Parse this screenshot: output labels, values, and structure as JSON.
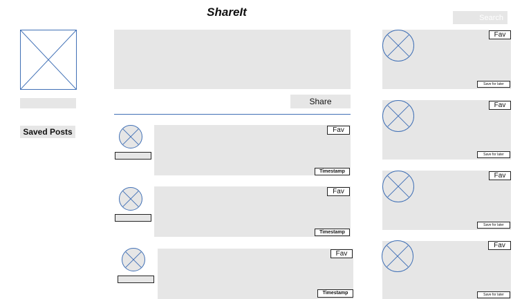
{
  "header": {
    "title": "ShareIt",
    "search_placeholder": "Search"
  },
  "sidebar": {
    "saved_posts_label": "Saved Posts"
  },
  "composer": {
    "share_label": "Share"
  },
  "feed": {
    "posts": [
      {
        "fav_label": "Fav",
        "timestamp_label": "Timestamp"
      },
      {
        "fav_label": "Fav",
        "timestamp_label": "Timestamp"
      },
      {
        "fav_label": "Fav",
        "timestamp_label": "Timestamp"
      }
    ]
  },
  "suggestions": {
    "cards": [
      {
        "fav_label": "Fav",
        "save_label": "Save for later"
      },
      {
        "fav_label": "Fav",
        "save_label": "Save for later"
      },
      {
        "fav_label": "Fav",
        "save_label": "Save for later"
      },
      {
        "fav_label": "Fav",
        "save_label": "Save for later"
      }
    ]
  },
  "colors": {
    "accent": "#3f6fb5",
    "placeholder_gray": "#e6e6e6"
  }
}
